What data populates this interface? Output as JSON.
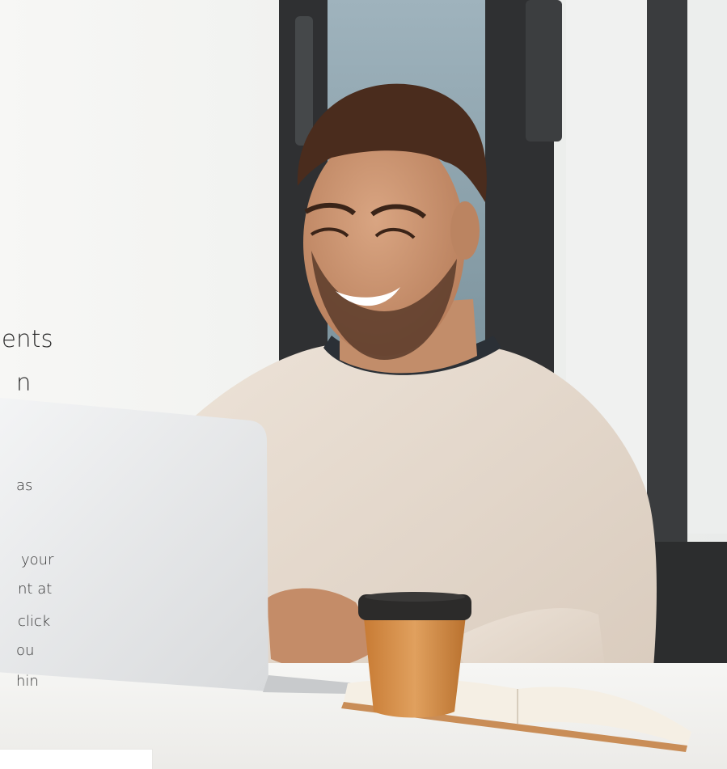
{
  "hero": {
    "image_alt": "Smiling man typing on a laptop at a white desk with a takeaway coffee cup and an open notebook"
  },
  "headline": {
    "lines": [
      "ents",
      "n"
    ]
  },
  "body": {
    "lines": [
      "as",
      "",
      "your",
      "nt at",
      "click",
      "ou",
      "hin"
    ]
  },
  "colors": {
    "background": "#ffffff",
    "text": "#2a2a2a",
    "sweater": "#e6d9cc",
    "coffee_cup": "#d48b43",
    "window_frame": "#2f3032"
  }
}
